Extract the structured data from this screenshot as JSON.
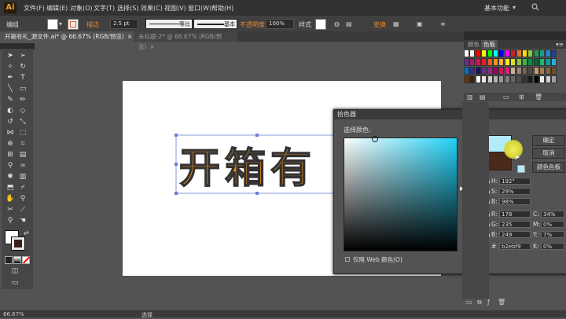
{
  "app": {
    "logo": "Ai",
    "workspace": "基本功能",
    "workspace_chevron": "▾"
  },
  "menu": [
    "文件(F)",
    "编辑(E)",
    "对象(O)",
    "文字(T)",
    "选择(S)",
    "效果(C)",
    "视图(V)",
    "窗口(W)",
    "帮助(H)"
  ],
  "control": {
    "mode_label": "编组",
    "stroke_label": "描边",
    "stroke_value": "2.5 pt",
    "stroke_style_label": "等比",
    "brush_label": "基本",
    "opacity_label": "不透明度",
    "opacity_value": "100%",
    "style_label": "样式",
    "transform_label": "变换",
    "fill_color": "#ffffff",
    "stroke_color": "#e05a28"
  },
  "tabs": [
    {
      "label": "开箱有礼_源文件.ai* @ 66.67% (RGB/预览)",
      "close": "×"
    },
    {
      "label": "未标题-2* @ 66.67% (RGB/预览)",
      "close": "×"
    }
  ],
  "art": {
    "text": "开箱有",
    "fill": "#f08a14",
    "stroke": "#333333"
  },
  "picker": {
    "title": "拾色器",
    "select_label": "选择颜色:",
    "ok": "确定",
    "cancel": "取消",
    "swatches": "颜色色板",
    "web_only": "仅限 Web 颜色(O)",
    "new_color": "#b2ebf9",
    "old_color": "#4a2a1a",
    "fields": {
      "H": "192°",
      "S": "29%",
      "B": "98%",
      "R": "178",
      "G": "235",
      "Bb": "249",
      "hex": "b2ebf9",
      "C": "34%",
      "M": "0%",
      "Y": "7%",
      "K": "0%"
    },
    "labels": {
      "H": "H:",
      "S": "S:",
      "B": "B:",
      "R": "R:",
      "G": "G:",
      "Bb": "B:",
      "hex": "#",
      "C": "C:",
      "M": "M:",
      "Y": "Y:",
      "K": "K:"
    }
  },
  "panels": {
    "tab1": "颜色",
    "tab2": "色板",
    "menu": "▾≡"
  },
  "status": {
    "zoom": "66.67%",
    "tool": "选择"
  },
  "swatch_colors": [
    "#ffffff",
    "#f4f4f4",
    "#ff0000",
    "#ffff00",
    "#00ff00",
    "#00ffff",
    "#0000ff",
    "#ff00ff",
    "#c8202a",
    "#e0762c",
    "#f7e000",
    "#8cc63e",
    "#20a04a",
    "#1aa08c",
    "#1c8dd2",
    "#2b3990",
    "#662d91",
    "#9e1f63",
    "#d4145a",
    "#ed1c24",
    "#f15a24",
    "#f7931e",
    "#fbb03b",
    "#fcee21",
    "#d9e021",
    "#8cc63f",
    "#39b54a",
    "#009245",
    "#006837",
    "#22b573",
    "#00a99d",
    "#29abe2",
    "#0071bc",
    "#2e3192",
    "#1b1464",
    "#662d91",
    "#93278f",
    "#9e005d",
    "#d4145a",
    "#ed1e79",
    "#c7b299",
    "#998675",
    "#736357",
    "#534741",
    "#c69c6d",
    "#a67c52",
    "#8c6239",
    "#754c24",
    "#603813",
    "#42210b",
    "#ffffff",
    "#e6e6e6",
    "#cccccc",
    "#b3b3b3",
    "#999999",
    "#808080",
    "#666666",
    "#4d4d4d",
    "#333333",
    "#1a1a1a",
    "#000000",
    "#f0f0f0",
    "#d0d0d0",
    "#a0a0a0"
  ]
}
